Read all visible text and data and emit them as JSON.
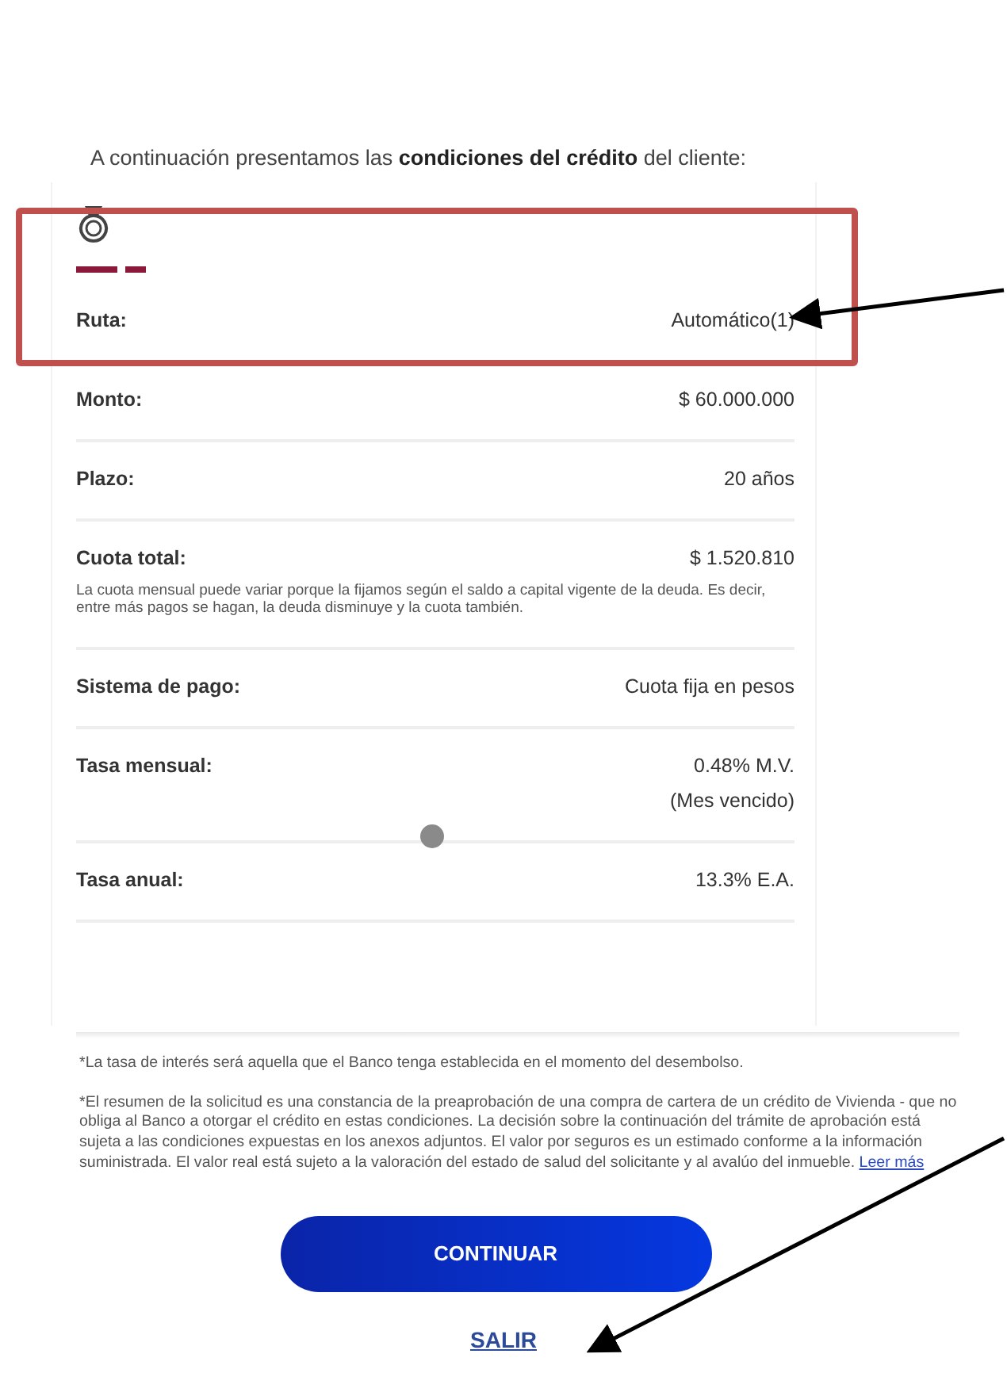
{
  "intro": "A continuación presentamos las **condiciones del crédito** del cliente:",
  "rows": [
    {
      "label": "Ruta:",
      "values": [
        "Automático(1)"
      ]
    },
    {
      "label": "Monto:",
      "values": [
        "$ 60.000.000"
      ]
    },
    {
      "label": "Plazo:",
      "values": [
        "20 años"
      ]
    },
    {
      "label": "Cuota total:",
      "values": [
        "$ 1.520.810"
      ],
      "note": "La cuota mensual puede variar porque la fijamos según el saldo a capital vigente de la deuda. Es decir, entre más pagos se hagan, la deuda disminuye y la cuota también."
    },
    {
      "label": "Sistema de pago:",
      "values": [
        "Cuota fija en pesos"
      ]
    },
    {
      "label": "Tasa mensual:",
      "values": [
        "0.48% M.V.",
        "(Mes vencido)"
      ]
    },
    {
      "label": "Tasa anual:",
      "values": [
        "13.3% E.A."
      ]
    }
  ],
  "footnotes": [
    {
      "text": "*La tasa de interés será aquella que el Banco tenga establecida en el momento del desembolso."
    },
    {
      "text": "*El resumen de la solicitud es una constancia de la preaprobación de una compra de cartera de un crédito de Vivienda - que no obliga al Banco a otorgar el crédito en estas condiciones. La decisión sobre la continuación del trámite de aprobación está sujeta a las condiciones expuestas en los anexos adjuntos. El valor por seguros es un estimado conforme a la información suministrada. El valor real está sujeto a la valoración del estado de salud del solicitante y al avalúo del inmueble.",
      "link": "Leer más"
    }
  ],
  "primary_button": "CONTINUAR",
  "exit_link": "SALIR"
}
